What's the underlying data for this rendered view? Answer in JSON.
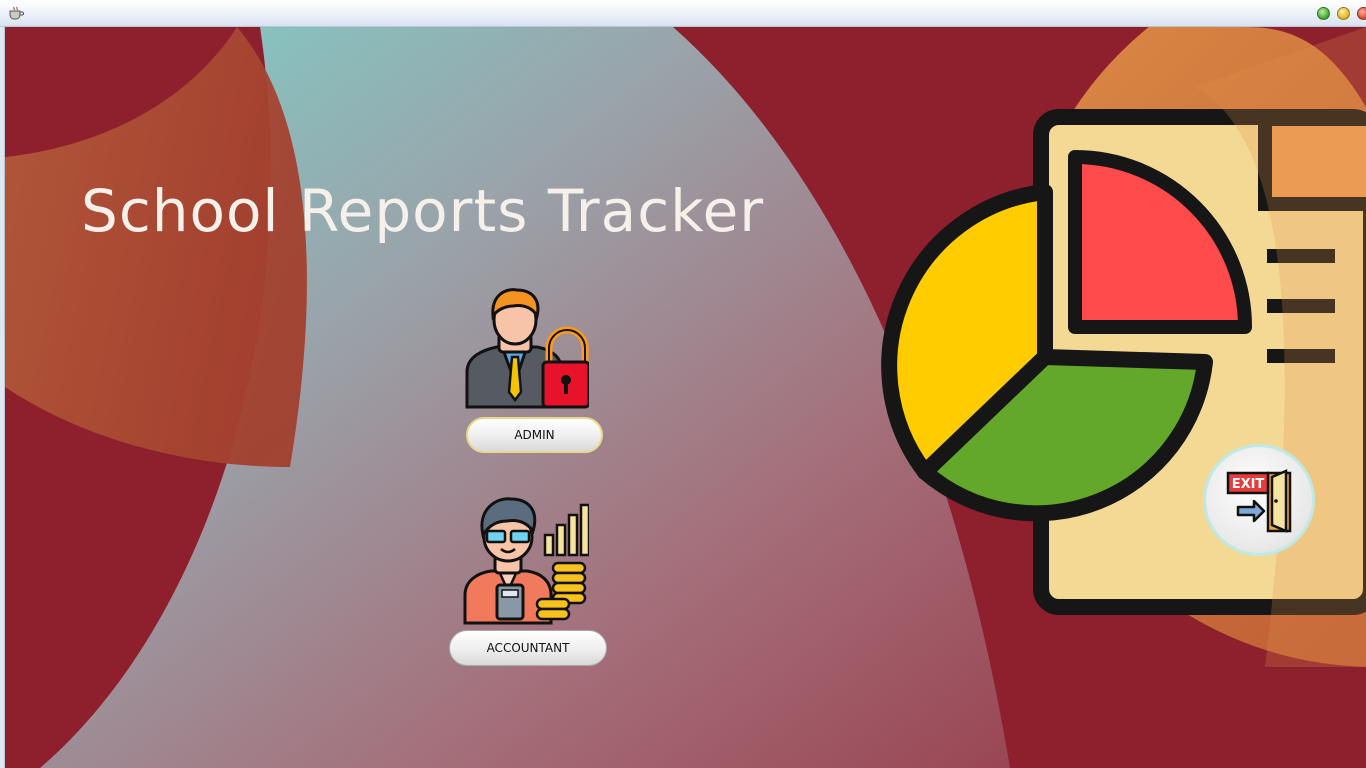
{
  "window": {
    "icon": "java-cup-icon",
    "controls": [
      "minimize-button",
      "maximize-button",
      "close-button"
    ]
  },
  "main": {
    "title": "School Reports Tracker",
    "roles": [
      {
        "icon": "admin-lock-icon",
        "label": "ADMIN"
      },
      {
        "icon": "accountant-icon",
        "label": "ACCOUNTANT"
      }
    ],
    "exit": {
      "icon": "exit-door-icon",
      "sign_text": "EXIT"
    }
  },
  "colors": {
    "background": "#8e1f2c",
    "accent_orange": "#e08a3c",
    "title_text": "#f6f0ea"
  }
}
